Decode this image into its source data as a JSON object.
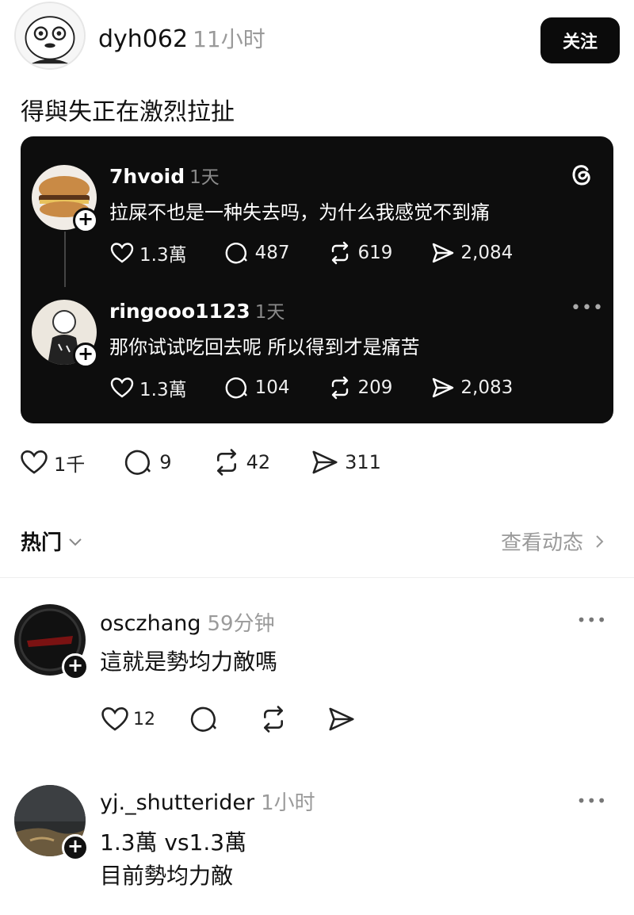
{
  "post": {
    "author": "dyh062",
    "time": "11小时",
    "follow_label": "关注",
    "text": "得與失正在激烈拉扯",
    "stats": {
      "likes": "1千",
      "replies": "9",
      "reposts": "42",
      "shares": "311"
    }
  },
  "quote": {
    "first": {
      "author": "7hvoid",
      "time": "1天",
      "text": "拉屎不也是一种失去吗，为什么我感觉不到痛",
      "stats": {
        "likes": "1.3萬",
        "replies": "487",
        "reposts": "619",
        "shares": "2,084"
      }
    },
    "second": {
      "author": "ringooo1123",
      "time": "1天",
      "text": "那你试试吃回去呢 所以得到才是痛苦",
      "stats": {
        "likes": "1.3萬",
        "replies": "104",
        "reposts": "209",
        "shares": "2,083"
      }
    }
  },
  "section": {
    "sort_label": "热门",
    "activity_label": "查看动态"
  },
  "replies": [
    {
      "author": "osczhang",
      "time": "59分钟",
      "text_lines": [
        "這就是勢均力敵嗎"
      ],
      "likes": "12"
    },
    {
      "author": "yj._shutterider",
      "time": "1小时",
      "text_lines": [
        "1.3萬 vs1.3萬",
        "目前勢均力敵"
      ]
    }
  ],
  "icons": {
    "more": "•••",
    "plus": "+"
  },
  "colors": {
    "card_bg": "#0d0d0d",
    "follow_bg": "#0b0b0b",
    "muted": "#9a9a9a"
  }
}
